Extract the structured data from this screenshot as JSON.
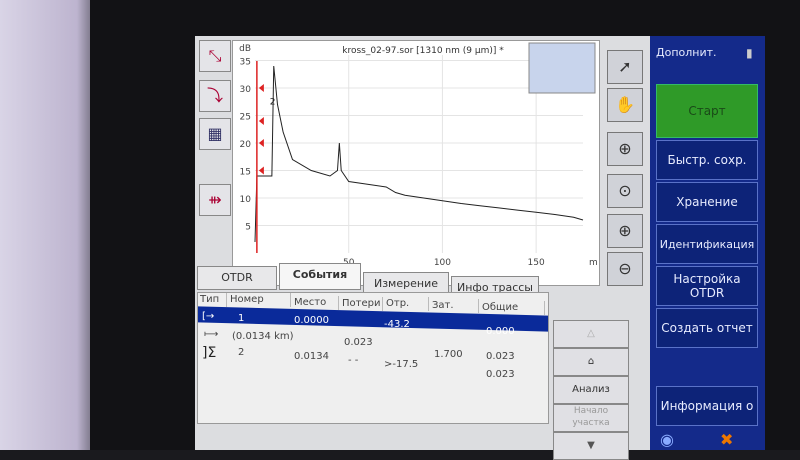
{
  "chart": {
    "title": "kross_02-97.sor [1310 nm (9 µm)] *",
    "y_unit": "dB",
    "x_unit": "m",
    "y_ticks": [
      35,
      30,
      25,
      20,
      15,
      10,
      5
    ],
    "x_ticks": [
      50,
      100,
      150
    ],
    "xlim": [
      0,
      175
    ],
    "ylim": [
      0,
      36
    ],
    "trace": [
      [
        0,
        2
      ],
      [
        1,
        14
      ],
      [
        8,
        14
      ],
      [
        9,
        14
      ],
      [
        10,
        34
      ],
      [
        12,
        27
      ],
      [
        15,
        22
      ],
      [
        20,
        17
      ],
      [
        30,
        15
      ],
      [
        40,
        14
      ],
      [
        44,
        15
      ],
      [
        45,
        20
      ],
      [
        46,
        15
      ],
      [
        50,
        13
      ],
      [
        60,
        12.5
      ],
      [
        70,
        12
      ],
      [
        75,
        11
      ],
      [
        80,
        10.5
      ],
      [
        90,
        10
      ],
      [
        100,
        9.5
      ],
      [
        110,
        9
      ],
      [
        120,
        8.6
      ],
      [
        130,
        8.2
      ],
      [
        140,
        7.8
      ],
      [
        150,
        7.4
      ],
      [
        160,
        7
      ],
      [
        170,
        6.5
      ],
      [
        175,
        6
      ]
    ],
    "marker_label": "2"
  },
  "tabs": [
    "OTDR",
    "События",
    "Измерение",
    "Инфо трассы"
  ],
  "table": {
    "headers": [
      "Тип",
      "Номер",
      "Место",
      "Потери",
      "Отр.",
      "Зат.",
      "Общие"
    ],
    "rows": [
      {
        "num": "1",
        "place": "0.0000",
        "refl": "-43.2",
        "total": "0.000"
      },
      {
        "num": "(0.0134 km)",
        "loss": "0.023",
        "total": ""
      },
      {
        "num": "2",
        "place": "0.0134",
        "loss": "- -",
        "refl": ">-17.5",
        "att": "1.700",
        "total": "0.023"
      },
      {
        "total": "0.023"
      }
    ]
  },
  "event_buttons": {
    "up": "△",
    "zoom": "⌂",
    "analyze": "Анализ",
    "section_start": "Начало участка",
    "down": "▼"
  },
  "sidebar": {
    "title": "Дополнит.",
    "start": "Старт",
    "quick_save": "Быстр. сохр.",
    "storage": "Хранение",
    "identification": "Идентификация",
    "otdr_setup": "Настройка OTDR",
    "report": "Создать отчет",
    "info": "Информация о"
  },
  "colors": {
    "start": "#2f9a28",
    "selection": "#0a2a9a",
    "sidebar": "#142a8a"
  }
}
